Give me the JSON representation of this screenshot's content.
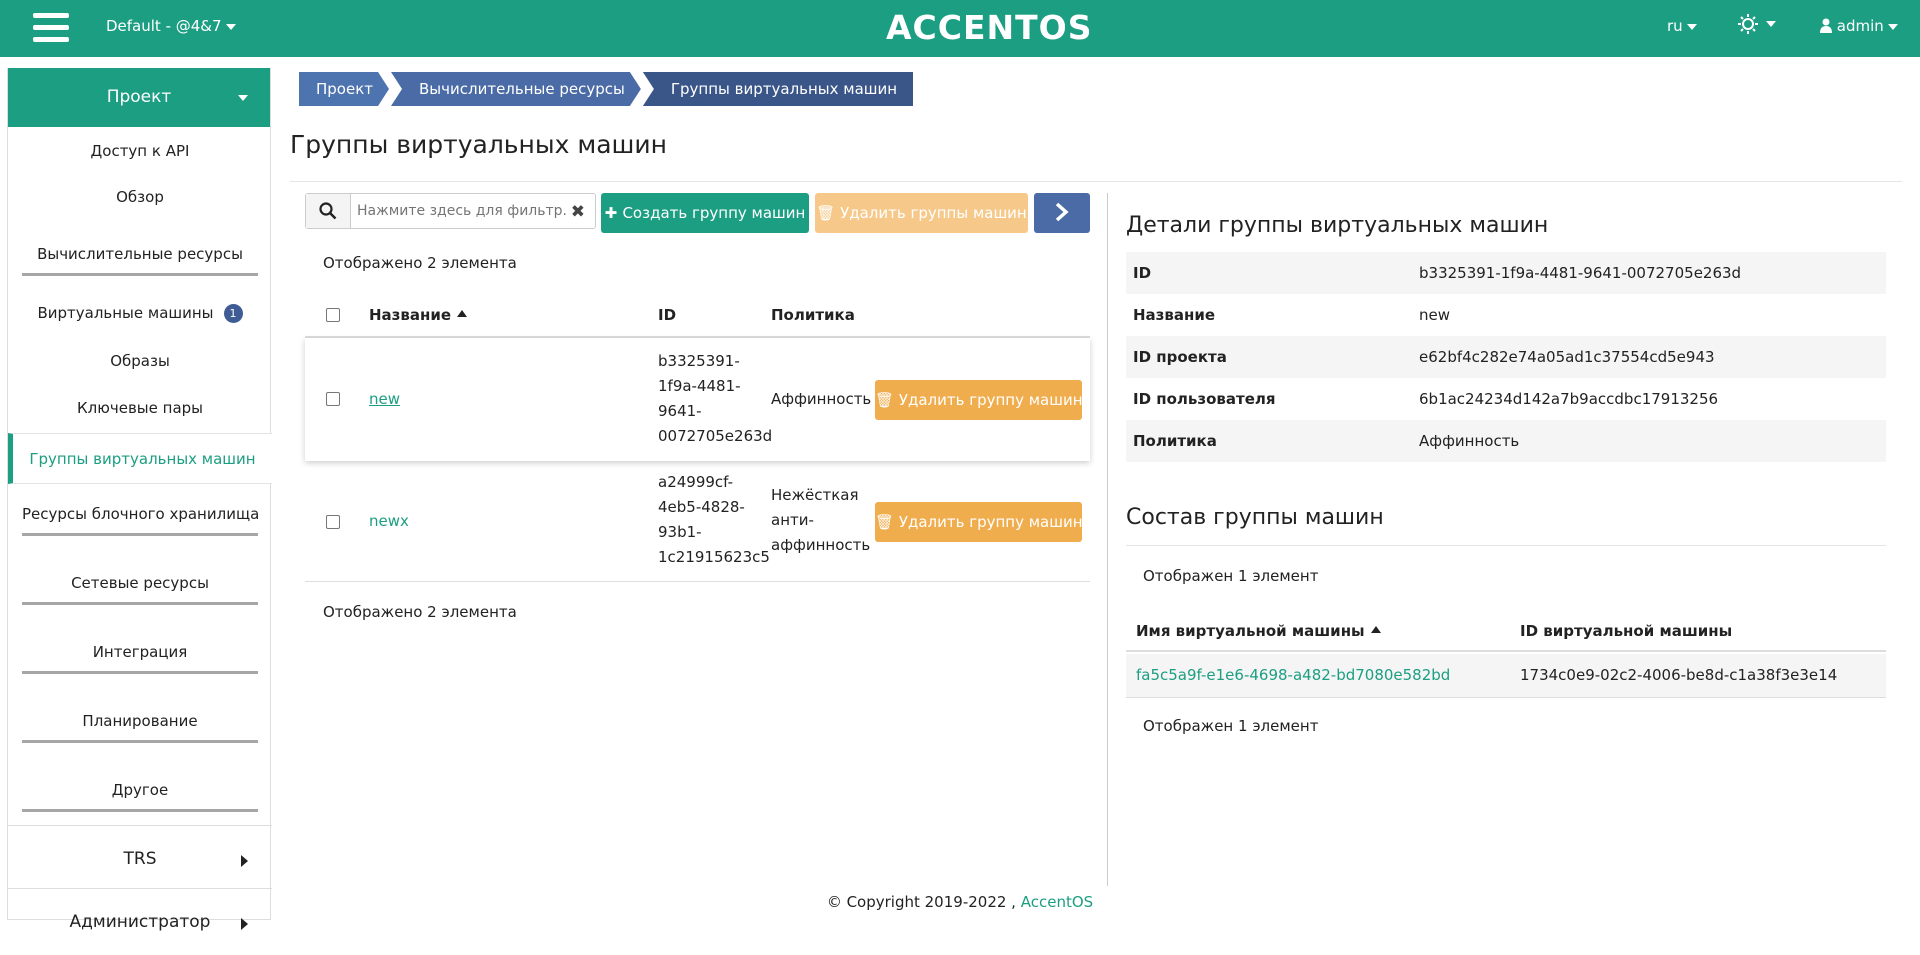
{
  "header": {
    "project_selector": "Default - @4&7",
    "logo": "ACCENTOS",
    "lang": "ru",
    "user": "admin"
  },
  "sidebar": {
    "project_label": "Проект",
    "items": [
      {
        "label": "Доступ к API"
      },
      {
        "label": "Обзор"
      },
      {
        "label": "Вычислительные ресурсы"
      },
      {
        "label": "Виртуальные машины",
        "badge": "1"
      },
      {
        "label": "Образы"
      },
      {
        "label": "Ключевые пары"
      },
      {
        "label": "Группы виртуальных машин"
      },
      {
        "label": "Ресурсы блочного хранилища"
      },
      {
        "label": "Сетевые ресурсы"
      },
      {
        "label": "Интеграция"
      },
      {
        "label": "Планирование"
      },
      {
        "label": "Другое"
      }
    ],
    "sections": [
      {
        "label": "TRS"
      },
      {
        "label": "Администратор"
      }
    ]
  },
  "breadcrumb": [
    "Проект",
    "Вычислительные ресурсы",
    "Группы виртуальных машин"
  ],
  "page_title": "Группы виртуальных машин",
  "toolbar": {
    "search_placeholder": "Нажмите здесь для фильтр...",
    "create_label": "Создать группу машин",
    "delete_label": "Удалить группы машин"
  },
  "table": {
    "count_text": "Отображено 2 элемента",
    "columns": [
      "Название",
      "ID",
      "Политика"
    ],
    "rows": [
      {
        "name": "new",
        "id_lines": [
          "b3325391-",
          "1f9a-4481-",
          "9641-",
          "0072705e263d"
        ],
        "policy_lines": [
          "Аффинность"
        ],
        "action": "Удалить группу машин"
      },
      {
        "name": "newx",
        "id_lines": [
          "a24999cf-",
          "4eb5-4828-",
          "93b1-",
          "1c21915623c5"
        ],
        "policy_lines": [
          "Нежёсткая",
          "анти-",
          "аффинность"
        ],
        "action": "Удалить группу машин"
      }
    ]
  },
  "details": {
    "title": "Детали группы виртуальных машин",
    "rows": [
      {
        "label": "ID",
        "value": "b3325391-1f9a-4481-9641-0072705e263d"
      },
      {
        "label": "Название",
        "value": "new"
      },
      {
        "label": "ID проекта",
        "value": "e62bf4c282e74a05ad1c37554cd5e943"
      },
      {
        "label": "ID пользователя",
        "value": "6b1ac24234d142a7b9accdbc17913256"
      },
      {
        "label": "Политика",
        "value": "Аффинность"
      }
    ]
  },
  "members": {
    "title": "Состав группы машин",
    "count_text": "Отображен 1 элемент",
    "columns": [
      "Имя виртуальной машины",
      "ID виртуальной машины"
    ],
    "rows": [
      {
        "name": "fa5c5a9f-e1e6-4698-a482-bd7080e582bd",
        "id": "1734c0e9-02c2-4006-be8d-c1a38f3e3e14"
      }
    ]
  },
  "footer": {
    "copyright": "© Copyright 2019-2022 ,",
    "link": "AccentOS"
  },
  "colors": {
    "brand_green": "#1c9e82",
    "breadcrumb_blue": "#4a6ba5",
    "warning_orange": "#f0ad4e"
  }
}
